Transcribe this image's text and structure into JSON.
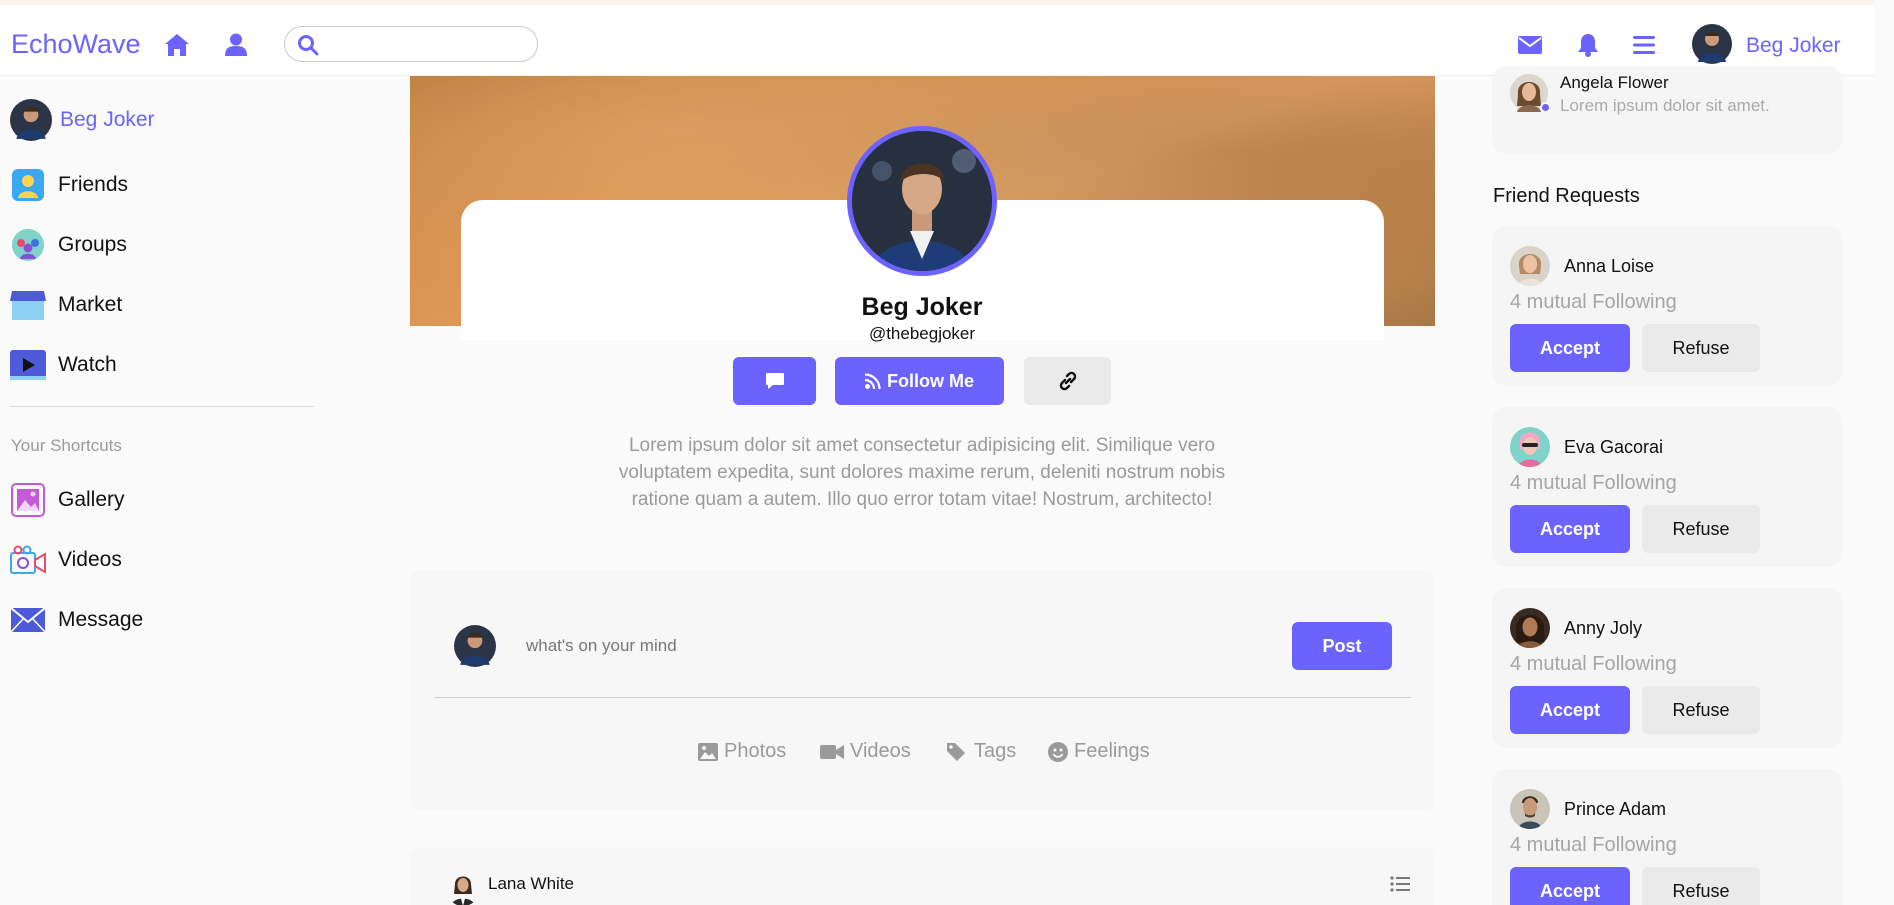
{
  "app": {
    "name": "EchoWave"
  },
  "header": {
    "search": {
      "value": "",
      "placeholder": ""
    },
    "user_name": "Beg Joker"
  },
  "sidebar": {
    "profile_name": "Beg Joker",
    "items": [
      {
        "label": "Friends",
        "icon": "friends-icon"
      },
      {
        "label": "Groups",
        "icon": "groups-icon"
      },
      {
        "label": "Market",
        "icon": "market-icon"
      },
      {
        "label": "Watch",
        "icon": "watch-icon"
      }
    ],
    "shortcuts_title": "Your Shortcuts",
    "shortcuts": [
      {
        "label": "Gallery",
        "icon": "gallery-icon"
      },
      {
        "label": "Videos",
        "icon": "videos-icon"
      },
      {
        "label": "Message",
        "icon": "message-icon"
      }
    ]
  },
  "profile": {
    "name": "Beg Joker",
    "handle": "@thebegjoker",
    "follow_label": "Follow Me",
    "bio": "Lorem ipsum dolor sit amet consectetur adipisicing elit. Similique vero voluptatem expedita, sunt dolores maxime rerum, deleniti nostrum nobis ratione quam a autem. Illo quo error totam vitae! Nostrum, architecto!"
  },
  "composer": {
    "placeholder": "what's on your mind",
    "post_label": "Post",
    "options": [
      "Photos",
      "Videos",
      "Tags",
      "Feelings"
    ]
  },
  "post": {
    "author": "Lana White"
  },
  "messages": [
    {
      "name": "Angela Flower",
      "text": "Lorem ipsum dolor sit amet."
    }
  ],
  "friend_requests": {
    "title": "Friend Requests",
    "accept_label": "Accept",
    "refuse_label": "Refuse",
    "items": [
      {
        "name": "Anna Loise",
        "mutual": "4 mutual Following"
      },
      {
        "name": "Eva Gacorai",
        "mutual": "4 mutual Following"
      },
      {
        "name": "Anny Joly",
        "mutual": "4 mutual Following"
      },
      {
        "name": "Prince Adam",
        "mutual": "4 mutual Following"
      }
    ]
  },
  "colors": {
    "accent": "#6c63ff",
    "muted": "#9a9a9a",
    "card": "#f5f5f5"
  }
}
